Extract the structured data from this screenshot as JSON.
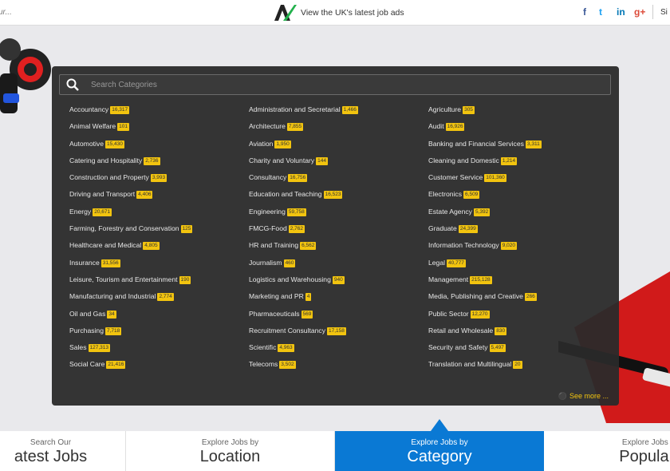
{
  "header": {
    "left_text": "ur...",
    "tagline": "View the UK's latest job ads",
    "social": [
      "f",
      "t",
      "in",
      "g+"
    ],
    "signin": "Si"
  },
  "search": {
    "placeholder": "Search Categories",
    "value": ""
  },
  "categories": {
    "col1": [
      {
        "label": "Accountancy",
        "count": "16,317"
      },
      {
        "label": "Animal Welfare",
        "count": "101"
      },
      {
        "label": "Automotive",
        "count": "15,430"
      },
      {
        "label": "Catering and Hospitality",
        "count": "2,736"
      },
      {
        "label": "Construction and Property",
        "count": "3,993"
      },
      {
        "label": "Driving and Transport",
        "count": "4,406"
      },
      {
        "label": "Energy",
        "count": "20,671"
      },
      {
        "label": "Farming, Forestry and Conservation",
        "count": "125"
      },
      {
        "label": "Healthcare and Medical",
        "count": "4,805"
      },
      {
        "label": "Insurance",
        "count": "31,556"
      },
      {
        "label": "Leisure, Tourism and Entertainment",
        "count": "190"
      },
      {
        "label": "Manufacturing and Industrial",
        "count": "2,774"
      },
      {
        "label": "Oil and Gas",
        "count": "34"
      },
      {
        "label": "Purchasing",
        "count": "7,718"
      },
      {
        "label": "Sales",
        "count": "127,313"
      },
      {
        "label": "Social Care",
        "count": "21,416"
      }
    ],
    "col2": [
      {
        "label": "Administration and Secretarial",
        "count": "1,466"
      },
      {
        "label": "Architecture",
        "count": "7,855"
      },
      {
        "label": "Aviation",
        "count": "1,950"
      },
      {
        "label": "Charity and Voluntary",
        "count": "144"
      },
      {
        "label": "Consultancy",
        "count": "16,756"
      },
      {
        "label": "Education and Teaching",
        "count": "16,523"
      },
      {
        "label": "Engineering",
        "count": "59,758"
      },
      {
        "label": "FMCG-Food",
        "count": "2,762"
      },
      {
        "label": "HR and Training",
        "count": "6,562"
      },
      {
        "label": "Journalism",
        "count": "460"
      },
      {
        "label": "Logistics and Warehousing",
        "count": "940"
      },
      {
        "label": "Marketing and PR",
        "count": "4"
      },
      {
        "label": "Pharmaceuticals",
        "count": "569"
      },
      {
        "label": "Recruitment Consultancy",
        "count": "17,158"
      },
      {
        "label": "Scientific",
        "count": "4,963"
      },
      {
        "label": "Telecoms",
        "count": "3,502"
      }
    ],
    "col3": [
      {
        "label": "Agriculture",
        "count": "305"
      },
      {
        "label": "Audit",
        "count": "16,926"
      },
      {
        "label": "Banking and Financial Services",
        "count": "3,311"
      },
      {
        "label": "Cleaning and Domestic",
        "count": "1,214"
      },
      {
        "label": "Customer Service",
        "count": "101,360"
      },
      {
        "label": "Electronics",
        "count": "6,509"
      },
      {
        "label": "Estate Agency",
        "count": "5,392"
      },
      {
        "label": "Graduate",
        "count": "24,399"
      },
      {
        "label": "Information Technology",
        "count": "9,020"
      },
      {
        "label": "Legal",
        "count": "40,777"
      },
      {
        "label": "Management",
        "count": "215,128"
      },
      {
        "label": "Media, Publishing and Creative",
        "count": "266"
      },
      {
        "label": "Public Sector",
        "count": "12,270"
      },
      {
        "label": "Retail and Wholesale",
        "count": "830"
      },
      {
        "label": "Security and Safety",
        "count": "5,497"
      },
      {
        "label": "Translation and Multilingual",
        "count": "20"
      }
    ]
  },
  "see_more": "See more ...",
  "tabs": [
    {
      "small": "Search Our",
      "big": "atest Jobs"
    },
    {
      "small": "Explore Jobs by",
      "big": "Location"
    },
    {
      "small": "Explore Jobs by",
      "big": "Category"
    },
    {
      "small": "Explore Jobs b",
      "big": "Populari"
    }
  ],
  "colors": {
    "accent": "#0a79d4",
    "badge": "#f2c40f",
    "panel": "#2a2a2a"
  }
}
